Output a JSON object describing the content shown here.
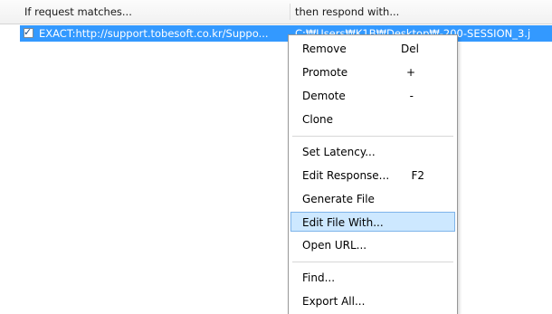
{
  "columns": {
    "match_header": "If request matches...",
    "respond_header": "then respond with..."
  },
  "rule": {
    "checked": true,
    "check_glyph": "✓",
    "match": "EXACT:http://support.tobesoft.co.kr/Suppo...",
    "respond": "C:₩Users₩K1B₩Desktop₩-200-SESSION_3.j"
  },
  "menu": {
    "remove": {
      "label": "Remove",
      "shortcut": "Del"
    },
    "promote": {
      "label": "Promote",
      "shortcut": "+"
    },
    "demote": {
      "label": "Demote",
      "shortcut": "-"
    },
    "clone": {
      "label": "Clone"
    },
    "set_latency": {
      "label": "Set Latency..."
    },
    "edit_response": {
      "label": "Edit Response...",
      "shortcut": "F2"
    },
    "generate_file": {
      "label": "Generate File"
    },
    "edit_file_with": {
      "label": "Edit File With..."
    },
    "open_url": {
      "label": "Open URL..."
    },
    "find": {
      "label": "Find..."
    },
    "export_all": {
      "label": "Export All..."
    }
  },
  "colors": {
    "selection": "#3399ff",
    "menu_hover_fill": "#cde8ff",
    "menu_hover_border": "#7eb4ea"
  }
}
